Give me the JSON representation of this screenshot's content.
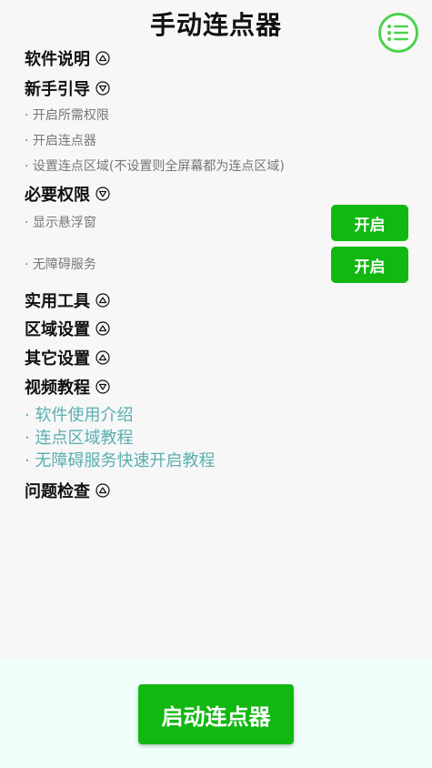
{
  "header": {
    "title": "手动连点器"
  },
  "sections": {
    "software_desc": "软件说明",
    "beginner_guide": "新手引导",
    "required_perm": "必要权限",
    "tools": "实用工具",
    "area_settings": "区域设置",
    "other_settings": "其它设置",
    "video_tutorial": "视频教程",
    "troubleshoot": "问题检查"
  },
  "guide_steps": [
    "· 开启所需权限",
    "· 开启连点器",
    "· 设置连点区域(不设置则全屏幕都为连点区域)"
  ],
  "permissions": {
    "overlay_label": "· 显示悬浮窗",
    "accessibility_label": "· 无障碍服务",
    "open_button": "开启"
  },
  "video_links": [
    "· 软件使用介绍",
    "· 连点区域教程",
    "· 无障碍服务快速开启教程"
  ],
  "footer": {
    "start_button": "启动连点器"
  },
  "colors": {
    "accent_green": "#12b812",
    "menu_ring": "#4cd24c",
    "link_teal": "#5aaeb0"
  }
}
